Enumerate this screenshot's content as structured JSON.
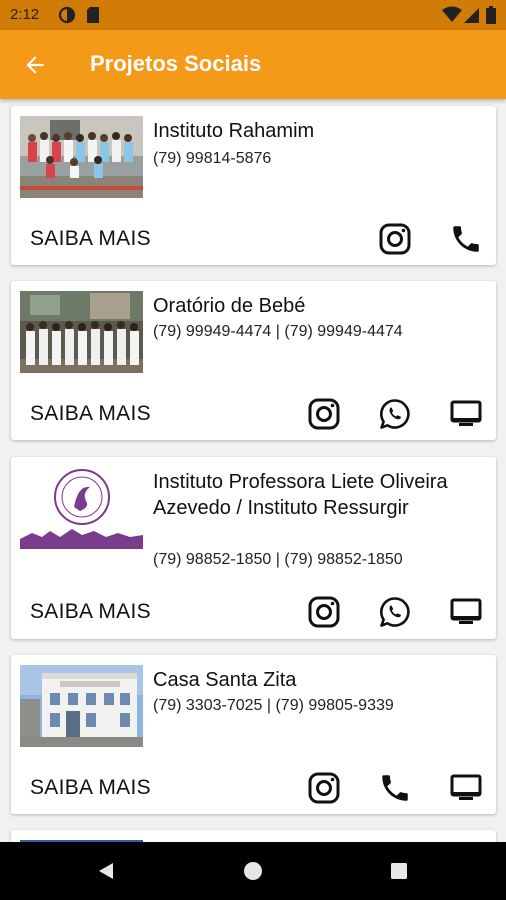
{
  "status": {
    "time": "2:12"
  },
  "app_bar": {
    "title": "Projetos Sociais"
  },
  "cards": [
    {
      "name": "Instituto Rahamim",
      "phone": "(79) 99814-5876",
      "cta": "SAIBA MAIS"
    },
    {
      "name": "Oratório de Bebé",
      "phone": "(79) 99949-4474 | (79) 99949-4474",
      "cta": "SAIBA MAIS"
    },
    {
      "name": "Instituto Professora Liete Oliveira Azevedo / Instituto Ressurgir",
      "phone": "(79) 98852-1850 | (79) 98852-1850",
      "cta": "SAIBA MAIS"
    },
    {
      "name": "Casa Santa Zita",
      "phone": "(79) 3303-7025 | (79) 99805-9339",
      "cta": "SAIBA MAIS"
    }
  ],
  "icons": {
    "back": "arrow-back-icon",
    "instagram": "instagram-icon",
    "phone": "phone-icon",
    "whatsapp": "whatsapp-icon",
    "website": "monitor-icon"
  },
  "colors": {
    "app_bar": "#f49a18",
    "status_bar": "#d07c06",
    "background": "#f1f1f1"
  }
}
